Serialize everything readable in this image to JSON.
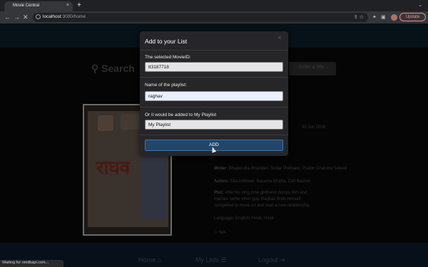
{
  "browser": {
    "tab_title": "Movie Central",
    "url_host": "localhost",
    "url_path": ":3000/home",
    "update_label": "Update",
    "status_text": "Waiting for omdbapi.com..."
  },
  "page": {
    "search_label": "Search",
    "search_placeholder": "Enter a title...",
    "release_date": "30 Jun 2016",
    "writer_label": "Writer:",
    "writer_value": "Bhupendra Bhandari, Sodar Pokharel, Prabin Chandra Subedi",
    "actors_label": "Actors:",
    "actors_value": "Sita Adhikari, Basanta Bhatta, Cell Basnet",
    "plot_label": "Plot:",
    "plot_line1": "After his long-time girlfriend dumps him and",
    "plot_line2": "marries some other guy, Raghav finds himself",
    "plot_line3": "compelled to move on and start a new relationship.",
    "language": "Language: English, Hindi, Hindi",
    "rating": "N/A",
    "footer": {
      "home": "Home",
      "my_lists": "My Lists",
      "logout": "Logout"
    }
  },
  "modal": {
    "title": "Add to your List",
    "movie_id_label": "The selected MovieID:",
    "movie_id_value": "tt3187718",
    "playlist_name_label": "Name of the playlist:",
    "playlist_name_value": "raghav",
    "default_label": "Or it would be added to My Playlist",
    "default_value": "My Playlist",
    "add_button": "ADD",
    "close_glyph": "×"
  },
  "colors": {
    "modal_bg": "#262629",
    "add_button": "#22456a",
    "update_accent": "#f28b82"
  }
}
